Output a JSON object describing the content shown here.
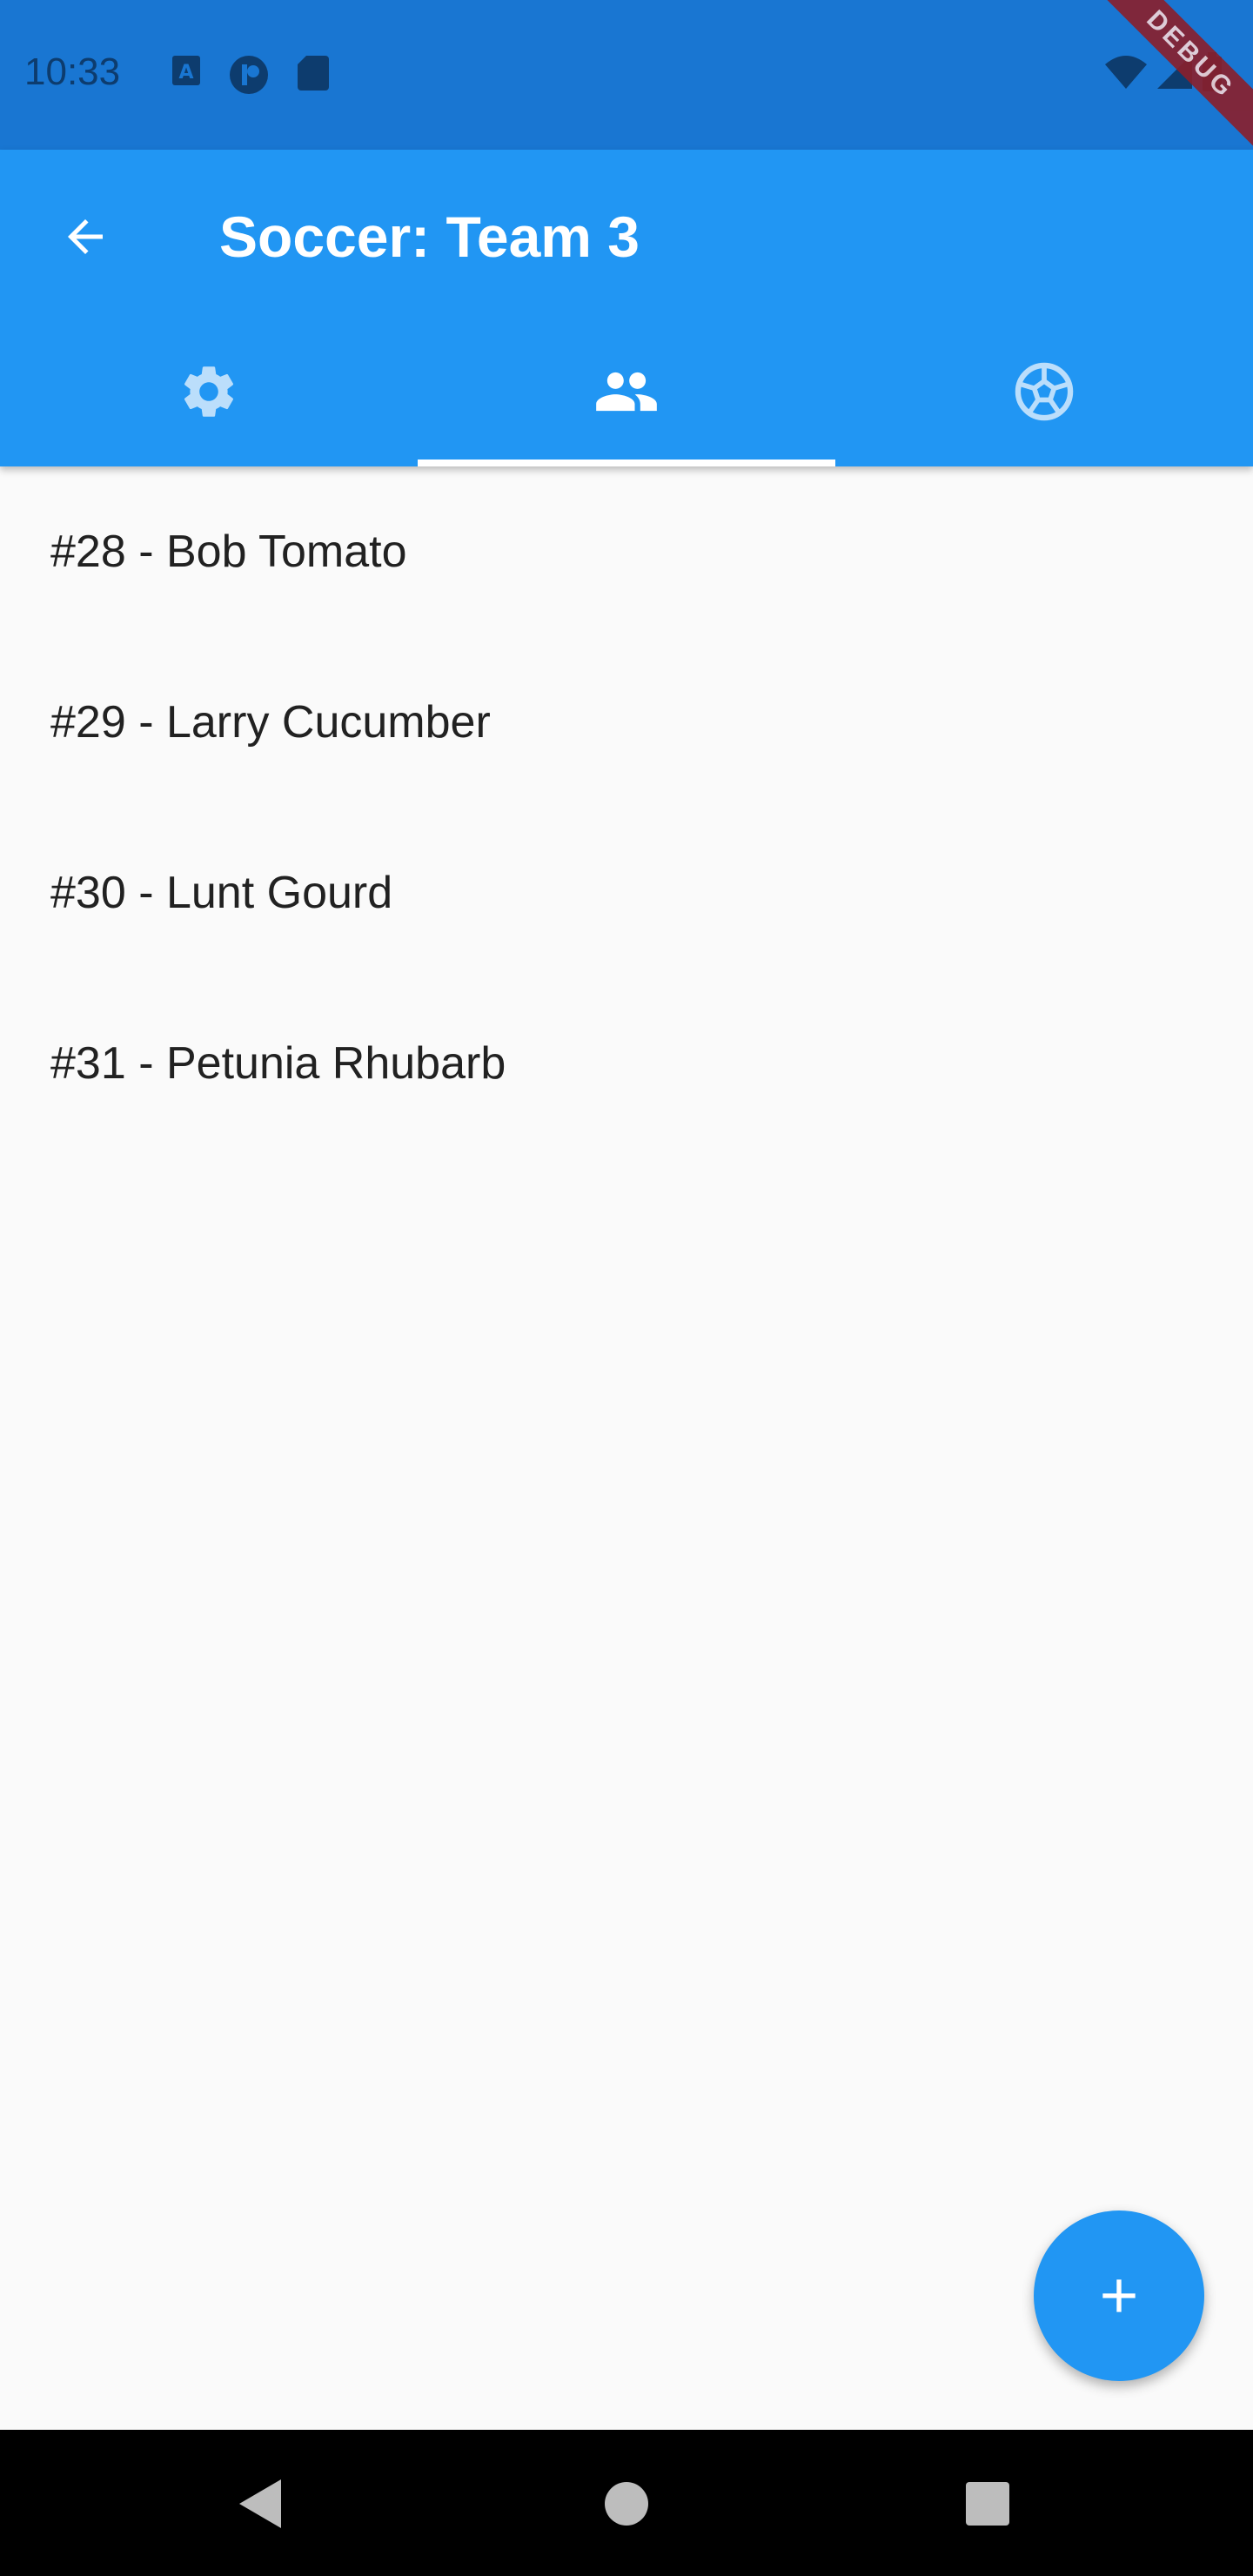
{
  "status_bar": {
    "time": "10:33",
    "left_icons": [
      "font-icon",
      "podcast-icon",
      "sd-card-icon"
    ],
    "right_icons": [
      "wifi-icon",
      "signal-icon",
      "battery-icon"
    ],
    "debug_banner": "DEBUG"
  },
  "app_bar": {
    "title": "Soccer: Team 3",
    "back_icon": "arrow-back-icon",
    "tabs": [
      {
        "name": "settings",
        "icon": "gear-icon",
        "selected": false
      },
      {
        "name": "players",
        "icon": "people-icon",
        "selected": true
      },
      {
        "name": "games",
        "icon": "soccer-ball-icon",
        "selected": false
      }
    ]
  },
  "players": [
    {
      "label": "#28 - Bob Tomato"
    },
    {
      "label": "#29 - Larry Cucumber"
    },
    {
      "label": "#30 - Lunt Gourd"
    },
    {
      "label": "#31 - Petunia Rhubarb"
    }
  ],
  "fab": {
    "icon": "plus-icon"
  },
  "colors": {
    "primary": "#2196f3",
    "primary_dark": "#1976d2",
    "background": "#fafafa",
    "text": "#212121",
    "unselected_tab": "#bbdefb"
  }
}
